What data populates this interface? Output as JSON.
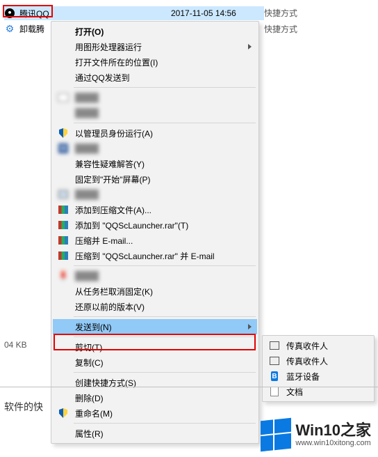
{
  "background": {
    "rows": [
      {
        "name": "腾讯QQ",
        "date": "2017-11-05 14:56",
        "type": "快捷方式"
      },
      {
        "name": "卸载腾",
        "date": "",
        "type": "快捷方式"
      }
    ],
    "status": "04 KB",
    "partialText": "软件的快"
  },
  "menu": {
    "open": "打开(O)",
    "runGpu": "用图形处理器运行",
    "openLocation": "打开文件所在的位置(I)",
    "sendQQ": "通过QQ发送到",
    "blur1": "████",
    "blur2": "████",
    "runAdmin": "以管理员身份运行(A)",
    "blur3": "████",
    "troubleshoot": "兼容性疑难解答(Y)",
    "pinStart": "固定到\"开始\"屏幕(P)",
    "blur4": "████",
    "addArchive": "添加到压缩文件(A)...",
    "addRarTo": "添加到 \"QQScLauncher.rar\"(T)",
    "compressEmail": "压缩并 E-mail...",
    "compressEmailTo": "压缩到 \"QQScLauncher.rar\" 并 E-mail",
    "blur5": "████",
    "unpinTaskbar": "从任务栏取消固定(K)",
    "restoreVersions": "还原以前的版本(V)",
    "sendTo": "发送到(N)",
    "cut": "剪切(T)",
    "copy": "复制(C)",
    "createShortcut": "创建快捷方式(S)",
    "delete": "删除(D)",
    "rename": "重命名(M)",
    "properties": "属性(R)"
  },
  "submenu": {
    "fax1": "传真收件人",
    "fax2": "传真收件人",
    "bluetooth": "蓝牙设备",
    "documents": "文档"
  },
  "watermark": {
    "title": "Win10之家",
    "url": "www.win10xitong.com"
  }
}
